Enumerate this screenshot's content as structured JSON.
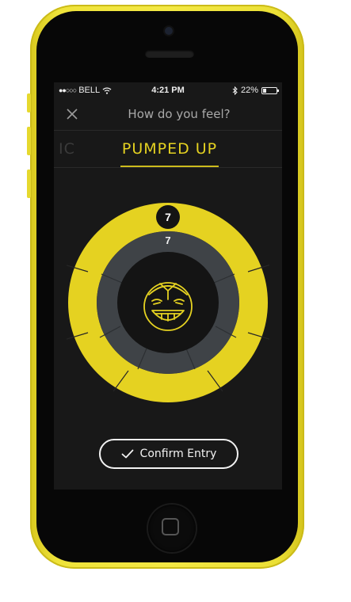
{
  "status_bar": {
    "signal": "●●○○○",
    "carrier": "BELL",
    "wifi_icon": "wifi-icon",
    "time": "4:21 PM",
    "bluetooth_icon": "bluetooth-icon",
    "battery_percent": "22%",
    "battery_level": 0.22
  },
  "header": {
    "close_icon": "close-icon",
    "title": "How do you feel?"
  },
  "mood_tabs": {
    "previous_label": "IC",
    "active_label": "PUMPED UP"
  },
  "mood_wheel": {
    "outer_value": "7",
    "inner_value": "7",
    "face_icon": "pumped-face-icon",
    "colors": {
      "outer": "#e5d221",
      "inner": "#3f4347",
      "center": "#141414",
      "accent": "#e5d221"
    }
  },
  "actions": {
    "confirm_label": "Confirm Entry",
    "confirm_icon": "checkmark-icon"
  }
}
